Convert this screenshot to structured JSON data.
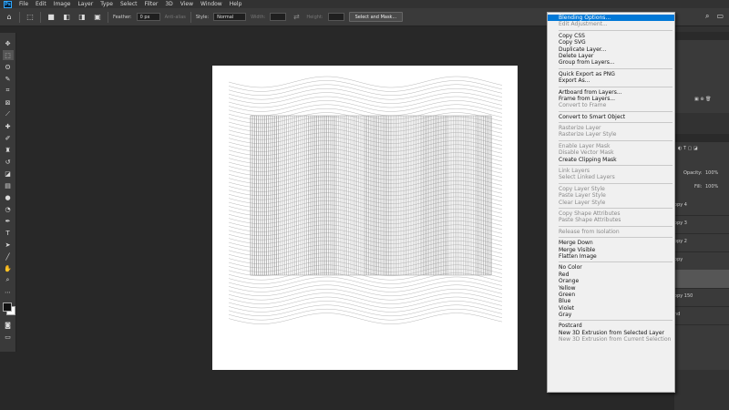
{
  "menubar": {
    "logo": "Ps",
    "items": [
      "File",
      "Edit",
      "Image",
      "Layer",
      "Type",
      "Select",
      "Filter",
      "3D",
      "View",
      "Window",
      "Help"
    ]
  },
  "options": {
    "feather_label": "Feather:",
    "feather_value": "0 px",
    "antialias_label": "Anti-alias",
    "style_label": "Style:",
    "style_value": "Normal",
    "width_label": "Width:",
    "height_label": "Height:",
    "select_mask_label": "Select and Mask..."
  },
  "layers_panel": {
    "opacity_label": "Opacity:",
    "opacity_value": "100%",
    "fill_label": "Fill:",
    "fill_value": "100%",
    "visible_rows": [
      {
        "fragment": "opy 4"
      },
      {
        "fragment": "opy 3"
      },
      {
        "fragment": "opy 2"
      },
      {
        "fragment": "opy"
      },
      {
        "fragment": ""
      },
      {
        "fragment": "opy 150"
      },
      {
        "fragment": "nd"
      }
    ]
  },
  "context_menu": {
    "groups": [
      [
        {
          "label": "Blending Options...",
          "state": "highlighted"
        },
        {
          "label": "Edit Adjustment...",
          "state": "disabled"
        }
      ],
      [
        {
          "label": "Copy CSS",
          "state": "enabled"
        },
        {
          "label": "Copy SVG",
          "state": "enabled"
        },
        {
          "label": "Duplicate Layer...",
          "state": "enabled"
        },
        {
          "label": "Delete Layer",
          "state": "enabled"
        },
        {
          "label": "Group from Layers...",
          "state": "enabled"
        }
      ],
      [
        {
          "label": "Quick Export as PNG",
          "state": "enabled"
        },
        {
          "label": "Export As...",
          "state": "enabled"
        }
      ],
      [
        {
          "label": "Artboard from Layers...",
          "state": "enabled"
        },
        {
          "label": "Frame from Layers...",
          "state": "enabled"
        },
        {
          "label": "Convert to Frame",
          "state": "disabled"
        }
      ],
      [
        {
          "label": "Convert to Smart Object",
          "state": "enabled"
        }
      ],
      [
        {
          "label": "Rasterize Layer",
          "state": "disabled"
        },
        {
          "label": "Rasterize Layer Style",
          "state": "disabled"
        }
      ],
      [
        {
          "label": "Enable Layer Mask",
          "state": "disabled"
        },
        {
          "label": "Disable Vector Mask",
          "state": "disabled"
        },
        {
          "label": "Create Clipping Mask",
          "state": "enabled"
        }
      ],
      [
        {
          "label": "Link Layers",
          "state": "disabled"
        },
        {
          "label": "Select Linked Layers",
          "state": "disabled"
        }
      ],
      [
        {
          "label": "Copy Layer Style",
          "state": "disabled"
        },
        {
          "label": "Paste Layer Style",
          "state": "disabled"
        },
        {
          "label": "Clear Layer Style",
          "state": "disabled"
        }
      ],
      [
        {
          "label": "Copy Shape Attributes",
          "state": "disabled"
        },
        {
          "label": "Paste Shape Attributes",
          "state": "disabled"
        }
      ],
      [
        {
          "label": "Release from Isolation",
          "state": "disabled"
        }
      ],
      [
        {
          "label": "Merge Down",
          "state": "enabled"
        },
        {
          "label": "Merge Visible",
          "state": "enabled"
        },
        {
          "label": "Flatten Image",
          "state": "enabled"
        }
      ],
      [
        {
          "label": "No Color",
          "state": "enabled"
        },
        {
          "label": "Red",
          "state": "enabled"
        },
        {
          "label": "Orange",
          "state": "enabled"
        },
        {
          "label": "Yellow",
          "state": "enabled"
        },
        {
          "label": "Green",
          "state": "enabled"
        },
        {
          "label": "Blue",
          "state": "enabled"
        },
        {
          "label": "Violet",
          "state": "enabled"
        },
        {
          "label": "Gray",
          "state": "enabled"
        }
      ],
      [
        {
          "label": "Postcard",
          "state": "enabled"
        },
        {
          "label": "New 3D Extrusion from Selected Layer",
          "state": "enabled"
        },
        {
          "label": "New 3D Extrusion from Current Selection",
          "state": "disabled"
        }
      ]
    ]
  },
  "colors": {
    "highlight": "#0078d7",
    "app_bg": "#282828",
    "panel_bg": "#3a3a3a",
    "canvas": "#ffffff"
  }
}
